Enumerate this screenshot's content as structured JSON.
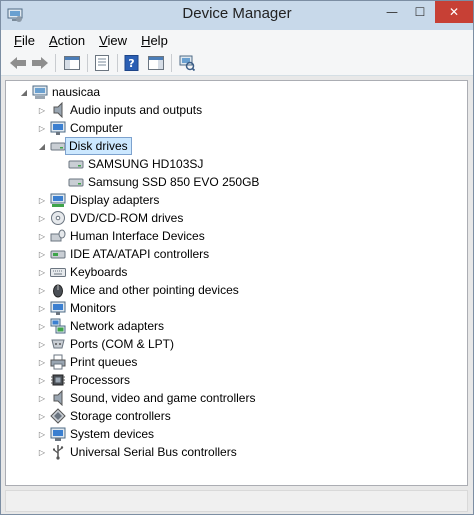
{
  "window": {
    "title": "Device Manager",
    "minimize_glyph": "—",
    "maximize_glyph": "☐",
    "close_glyph": "✕"
  },
  "menu": [
    {
      "accel": "F",
      "rest": "ile"
    },
    {
      "accel": "A",
      "rest": "ction"
    },
    {
      "accel": "V",
      "rest": "iew"
    },
    {
      "accel": "H",
      "rest": "elp"
    }
  ],
  "toolbar": {
    "buttons": [
      "back-icon",
      "forward-icon",
      "show-hide-console-tree-icon",
      "properties-icon",
      "help-icon",
      "action-pane-icon",
      "scan-hardware-icon"
    ]
  },
  "tree": {
    "root": {
      "label": "nausicaa",
      "icon": "computer-icon",
      "expanded": true
    },
    "categories": [
      {
        "label": "Audio inputs and outputs",
        "icon": "speaker-icon",
        "expanded": false
      },
      {
        "label": "Computer",
        "icon": "monitor-icon",
        "expanded": false
      },
      {
        "label": "Disk drives",
        "icon": "disk-drive-icon",
        "expanded": true,
        "selected": true,
        "children": [
          {
            "label": "SAMSUNG HD103SJ",
            "icon": "disk-drive-icon"
          },
          {
            "label": "Samsung SSD 850 EVO 250GB",
            "icon": "disk-drive-icon"
          }
        ]
      },
      {
        "label": "Display adapters",
        "icon": "display-adapter-icon",
        "expanded": false
      },
      {
        "label": "DVD/CD-ROM drives",
        "icon": "optical-drive-icon",
        "expanded": false
      },
      {
        "label": "Human Interface Devices",
        "icon": "hid-icon",
        "expanded": false
      },
      {
        "label": "IDE ATA/ATAPI controllers",
        "icon": "ide-controller-icon",
        "expanded": false
      },
      {
        "label": "Keyboards",
        "icon": "keyboard-icon",
        "expanded": false
      },
      {
        "label": "Mice and other pointing devices",
        "icon": "mouse-icon",
        "expanded": false
      },
      {
        "label": "Monitors",
        "icon": "monitor-icon",
        "expanded": false
      },
      {
        "label": "Network adapters",
        "icon": "network-icon",
        "expanded": false
      },
      {
        "label": "Ports (COM & LPT)",
        "icon": "port-icon",
        "expanded": false
      },
      {
        "label": "Print queues",
        "icon": "printer-icon",
        "expanded": false
      },
      {
        "label": "Processors",
        "icon": "processor-icon",
        "expanded": false
      },
      {
        "label": "Sound, video and game controllers",
        "icon": "speaker-icon",
        "expanded": false
      },
      {
        "label": "Storage controllers",
        "icon": "storage-controller-icon",
        "expanded": false
      },
      {
        "label": "System devices",
        "icon": "system-devices-icon",
        "expanded": false
      },
      {
        "label": "Universal Serial Bus controllers",
        "icon": "usb-icon",
        "expanded": false
      }
    ]
  },
  "colors": {
    "titlebar": "#c8d9ea",
    "close_button": "#c74035",
    "selection_fill": "#cce8ff",
    "selection_border": "#7da2ce"
  }
}
